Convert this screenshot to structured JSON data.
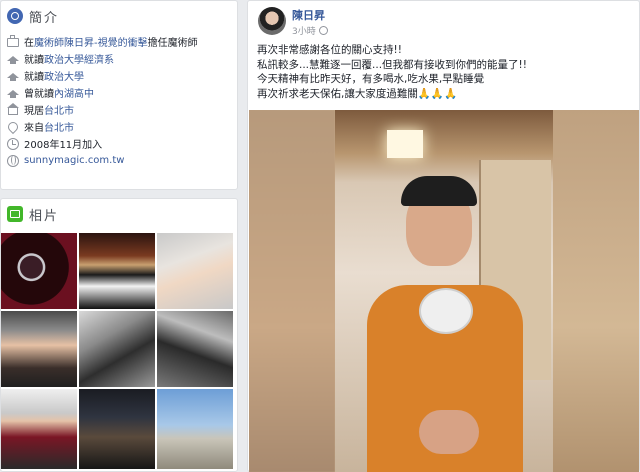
{
  "intro": {
    "title": "簡介",
    "items": [
      {
        "icon": "briefcase-icon",
        "prefix": "在",
        "link": "魔術師陳日昇-視覺的衝擊",
        "suffix": "擔任魔術師"
      },
      {
        "icon": "graduation-cap-icon",
        "prefix": "就讀",
        "link": "政治大學經濟系",
        "suffix": ""
      },
      {
        "icon": "graduation-cap-icon",
        "prefix": "就讀",
        "link": "政治大學",
        "suffix": ""
      },
      {
        "icon": "graduation-cap-icon",
        "prefix": "曾就讀",
        "link": "內湖高中",
        "suffix": ""
      },
      {
        "icon": "home-icon",
        "prefix": "現居",
        "link": "台北市",
        "suffix": ""
      },
      {
        "icon": "location-pin-icon",
        "prefix": "來自",
        "link": "台北市",
        "suffix": ""
      },
      {
        "icon": "clock-icon",
        "prefix": "2008年11月加入",
        "link": "",
        "suffix": ""
      },
      {
        "icon": "globe-icon",
        "prefix": "",
        "link": "sunnymagic.com.tw",
        "suffix": ""
      }
    ]
  },
  "photos": {
    "title": "相片"
  },
  "post": {
    "author": "陳日昇",
    "time": "3小時",
    "lines": [
      "再次非常感謝各位的關心支持!!",
      "私訊較多...慧難逐一回覆...但我都有接收到你們的能量了!!",
      "今天精神有比昨天好，有多喝水,吃水果,早點睡覺",
      "再次祈求老天保佑,讓大家度過難關🙏🙏🙏"
    ]
  }
}
